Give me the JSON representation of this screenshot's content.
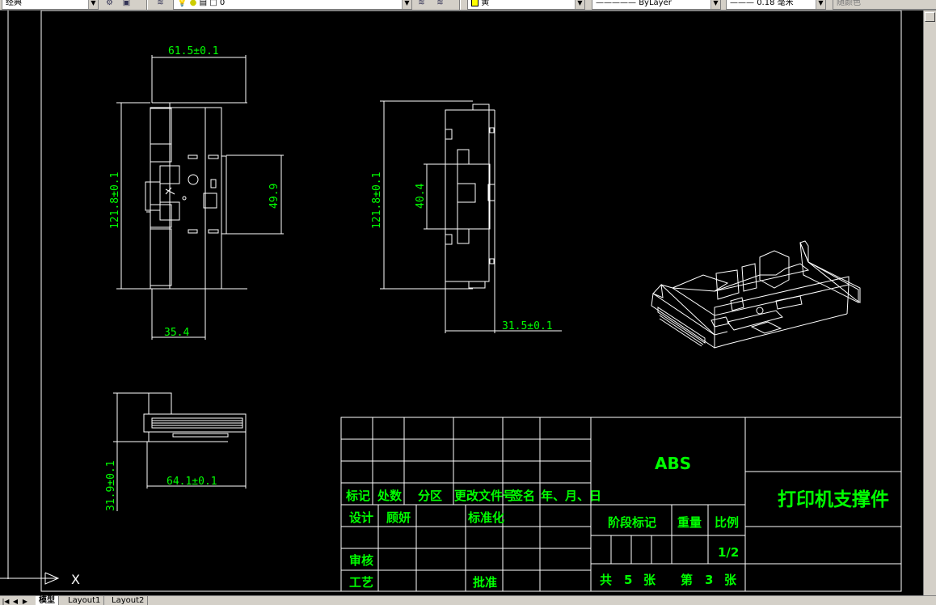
{
  "toolbar": {
    "style_name": "经典",
    "layer_name": "0",
    "color_name": "黄",
    "linetype": "ByLayer",
    "lineweight": "0.18 毫米",
    "plotstyle": "随颜色",
    "icons": [
      "workspace-settings-icon",
      "toolbar-icon",
      "layer-manager-icon",
      "lightbulb-icon",
      "sun-icon",
      "lock-icon",
      "color-square-icon",
      "layer-previous-icon",
      "layer-state-icon",
      "color-swatch-icon"
    ]
  },
  "dimensions": {
    "top_width": "61.5±0.1",
    "front_height": "121.8±0.1",
    "front_inner": "49.9",
    "front_bottom": "35.4",
    "side_height": "121.8±0.1",
    "side_inner": "40.4",
    "side_bottom": "31.5±0.1",
    "bottom_height": "31.9±0.1",
    "bottom_width": "64.1±0.1"
  },
  "title_block": {
    "material": "ABS",
    "part_name": "打印机支撑件",
    "header_row": [
      "标记",
      "处数",
      "分区",
      "更改文件号",
      "签名",
      "年、月、日"
    ],
    "design_label": "设计",
    "designer": "顾妍",
    "standard_label": "标准化",
    "review_label": "审核",
    "process_label": "工艺",
    "approve_label": "批准",
    "stage_label": "阶段标记",
    "weight_label": "重量",
    "scale_label": "比例",
    "scale_value": "1/2",
    "total_prefix": "共",
    "total_sheets": "5",
    "sheet_unit": "张",
    "current_prefix": "第",
    "current_sheet": "3",
    "current_unit": "张"
  },
  "ucs_label": "X",
  "tabs": [
    "模型",
    "Layout1",
    "Layout2"
  ],
  "colors": {
    "dimension": "#00ff00",
    "geometry": "#ffffff",
    "background": "#000000"
  }
}
